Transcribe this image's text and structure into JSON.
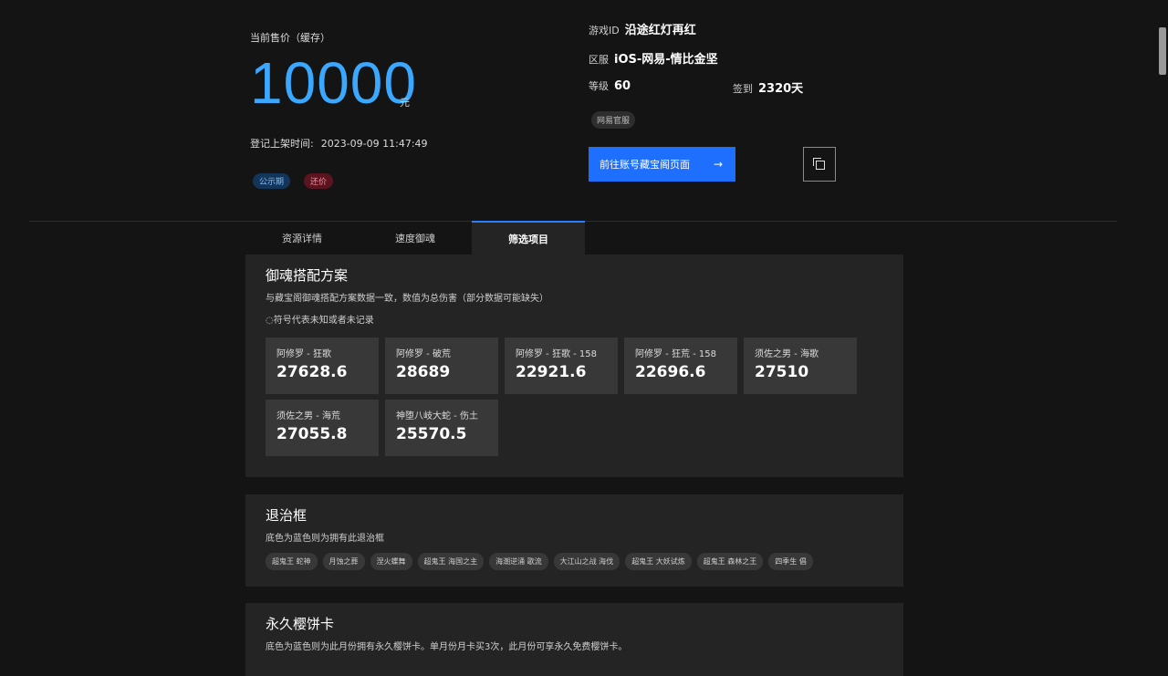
{
  "price": {
    "label": "当前售价（缓存）",
    "value": "10000",
    "unit": "元",
    "listed_label": "登记上架时间:",
    "listed_time": "2023-09-09 11:47:49",
    "tags": [
      "公示期",
      "还价"
    ]
  },
  "account": {
    "game_id_label": "游戏ID",
    "game_id": "沿途红灯再红",
    "server_label": "区服",
    "server": "iOS-网易-情比金坚",
    "level_label": "等级",
    "level": "60",
    "signin_label": "签到",
    "signin": "2320天",
    "server_tag": "网易官服",
    "goto_button": "前往账号藏宝阁页面",
    "copy_icon": "copy-icon"
  },
  "tabs": [
    {
      "label": "资源详情"
    },
    {
      "label": "速度御魂"
    },
    {
      "label": "筛选项目",
      "active": true
    }
  ],
  "yuhun": {
    "title": "御魂搭配方案",
    "desc": "与藏宝阁御魂搭配方案数据一致，数值为总伤害（部分数据可能缺失）",
    "note": "◌符号代表未知或者未记录",
    "cards": [
      {
        "name": "阿修罗 - 狂歌",
        "value": "27628.6"
      },
      {
        "name": "阿修罗 - 破荒",
        "value": "28689"
      },
      {
        "name": "阿修罗 - 狂歌 - 158",
        "value": "22921.6"
      },
      {
        "name": "阿修罗 - 狂荒 - 158",
        "value": "22696.6"
      },
      {
        "name": "须佐之男 - 海歌",
        "value": "27510"
      },
      {
        "name": "须佐之男 - 海荒",
        "value": "27055.8"
      },
      {
        "name": "神堕八岐大蛇 - 伤土",
        "value": "25570.5"
      }
    ]
  },
  "frames": {
    "title": "退治框",
    "desc": "底色为蓝色则为拥有此退治框",
    "chips": [
      "超鬼王 蛇神",
      "月蚀之葬",
      "涅火蝶舞",
      "超鬼王 海国之主",
      "海潮逆涌 歌流",
      "大江山之战 海伐",
      "超鬼王 大妖试炼",
      "超鬼王 森林之王",
      "四季生 倡"
    ]
  },
  "sakura": {
    "title": "永久樱饼卡",
    "desc": "底色为蓝色则为此月份拥有永久樱饼卡。单月份月卡买3次，此月份可享永久免费樱饼卡。"
  }
}
